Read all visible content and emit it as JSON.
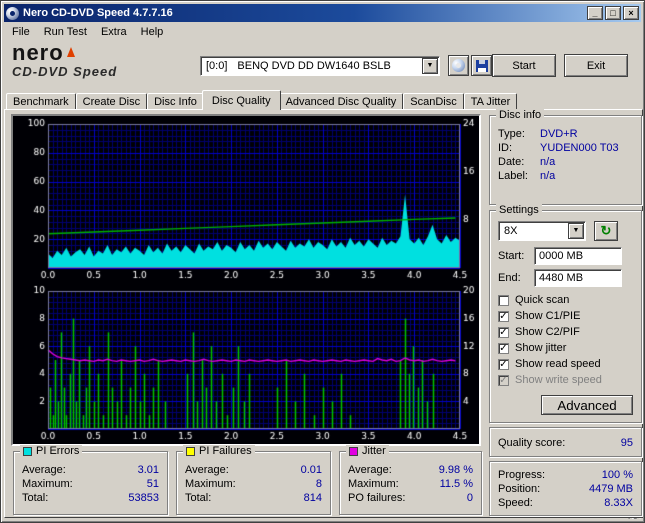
{
  "window": {
    "title": "Nero CD-DVD Speed 4.7.7.16"
  },
  "icons": {
    "minimize": "_",
    "maximize": "□",
    "close": "×",
    "dropdown": "▼",
    "refresh": "↻"
  },
  "menu": {
    "items": [
      "File",
      "Run Test",
      "Extra",
      "Help"
    ]
  },
  "logo": {
    "brand": "nero",
    "product": "CD-DVD Speed"
  },
  "toolbar": {
    "drive_bus": "[0:0]",
    "drive_name": "BENQ DVD DD DW1640 BSLB",
    "start_button": "Start",
    "exit_button": "Exit"
  },
  "tabs": {
    "items": [
      "Benchmark",
      "Create Disc",
      "Disc Info",
      "Disc Quality",
      "Advanced Disc Quality",
      "ScanDisc",
      "TA Jitter"
    ],
    "selected_index": 3
  },
  "disc_info": {
    "title": "Disc info",
    "rows": [
      {
        "label": "Type:",
        "value": "DVD+R"
      },
      {
        "label": "ID:",
        "value": "YUDEN000 T03"
      },
      {
        "label": "Date:",
        "value": "n/a"
      },
      {
        "label": "Label:",
        "value": "n/a"
      }
    ]
  },
  "settings": {
    "title": "Settings",
    "speed_value": "8X",
    "start_label": "Start:",
    "start_value": "0000 MB",
    "end_label": "End:",
    "end_value": "4480 MB",
    "checkboxes": [
      {
        "label": "Quick scan",
        "checked": false,
        "enabled": true
      },
      {
        "label": "Show C1/PIE",
        "checked": true,
        "enabled": true
      },
      {
        "label": "Show C2/PIF",
        "checked": true,
        "enabled": true
      },
      {
        "label": "Show jitter",
        "checked": true,
        "enabled": true
      },
      {
        "label": "Show read speed",
        "checked": true,
        "enabled": true
      },
      {
        "label": "Show write speed",
        "checked": true,
        "enabled": false
      }
    ],
    "advanced_button": "Advanced"
  },
  "quality": {
    "label": "Quality score:",
    "value": "95"
  },
  "progress": {
    "rows": [
      {
        "label": "Progress:",
        "value": "100 %"
      },
      {
        "label": "Position:",
        "value": "4479 MB"
      },
      {
        "label": "Speed:",
        "value": "8.33X"
      }
    ]
  },
  "stat_boxes": [
    {
      "title": "PI Errors",
      "swatch": "#00e0e0",
      "rows": [
        {
          "label": "Average:",
          "value": "3.01"
        },
        {
          "label": "Maximum:",
          "value": "51"
        },
        {
          "label": "Total:",
          "value": "53853"
        }
      ]
    },
    {
      "title": "PI Failures",
      "swatch": "#ffff00",
      "rows": [
        {
          "label": "Average:",
          "value": "0.01"
        },
        {
          "label": "Maximum:",
          "value": "8"
        },
        {
          "label": "Total:",
          "value": "814"
        }
      ]
    },
    {
      "title": "Jitter",
      "swatch": "#e000e0",
      "rows": [
        {
          "label": "Average:",
          "value": "9.98 %"
        },
        {
          "label": "Maximum:",
          "value": "11.5 %"
        },
        {
          "label": "PO failures:",
          "value": "0"
        }
      ]
    }
  ],
  "chart_data": [
    {
      "type": "area",
      "title": "PI Errors and read speed vs disc position (GB)",
      "x_range": [
        0,
        4.5
      ],
      "x_ticks": [
        0.0,
        0.5,
        1.0,
        1.5,
        2.0,
        2.5,
        3.0,
        3.5,
        4.0,
        4.5
      ],
      "left_axis": {
        "range": [
          0,
          100
        ],
        "ticks": [
          20,
          40,
          60,
          80,
          100
        ]
      },
      "right_axis": {
        "range": [
          0,
          24
        ],
        "ticks": [
          8,
          16,
          24
        ]
      },
      "grid": {
        "x_minor": 0.05,
        "x_major": 0.5,
        "y_minor": 4,
        "y_major": 20
      },
      "series": [
        {
          "name": "PI Errors",
          "type": "area",
          "axis": "left",
          "color": "#00e0e0",
          "x_step": 0.05,
          "values": [
            10,
            7,
            12,
            9,
            14,
            8,
            11,
            13,
            9,
            15,
            8,
            12,
            10,
            16,
            9,
            13,
            11,
            15,
            10,
            14,
            12,
            9,
            16,
            11,
            14,
            10,
            17,
            12,
            15,
            11,
            16,
            13,
            10,
            17,
            12,
            15,
            13,
            18,
            12,
            16,
            14,
            11,
            18,
            13,
            16,
            12,
            19,
            14,
            17,
            13,
            18,
            15,
            12,
            19,
            14,
            17,
            15,
            20,
            14,
            18,
            16,
            13,
            20,
            15,
            18,
            14,
            21,
            16,
            19,
            15,
            20,
            17,
            14,
            21,
            16,
            19,
            17,
            22,
            51,
            20,
            17,
            21,
            16,
            22,
            30,
            20,
            17,
            23,
            18,
            21,
            19
          ]
        },
        {
          "name": "Read speed",
          "type": "line",
          "axis": "right",
          "color": "#00b400",
          "x": [
            0,
            0.5,
            1.0,
            1.5,
            2.0,
            2.5,
            3.0,
            3.5,
            4.0,
            4.45
          ],
          "y": [
            5.7,
            6.0,
            6.3,
            6.6,
            6.9,
            7.2,
            7.5,
            7.8,
            8.1,
            8.33
          ]
        }
      ]
    },
    {
      "type": "bar",
      "title": "PI Failures and jitter vs disc position (GB)",
      "x_range": [
        0,
        4.5
      ],
      "x_ticks": [
        0.0,
        0.5,
        1.0,
        1.5,
        2.0,
        2.5,
        3.0,
        3.5,
        4.0,
        4.5
      ],
      "left_axis": {
        "range": [
          0,
          10
        ],
        "ticks": [
          2,
          4,
          6,
          8,
          10
        ]
      },
      "right_axis": {
        "range": [
          0,
          20
        ],
        "ticks": [
          4,
          8,
          12,
          16,
          20
        ]
      },
      "grid": {
        "x_minor": 0.05,
        "x_major": 0.5,
        "y_minor": 0.4,
        "y_major": 2
      },
      "series": [
        {
          "name": "PI Failures",
          "type": "bars",
          "axis": "left",
          "color": "#00c800",
          "points": [
            [
              0.02,
              3
            ],
            [
              0.05,
              1
            ],
            [
              0.08,
              5
            ],
            [
              0.11,
              2
            ],
            [
              0.14,
              7
            ],
            [
              0.17,
              3
            ],
            [
              0.2,
              1
            ],
            [
              0.24,
              4
            ],
            [
              0.27,
              8
            ],
            [
              0.31,
              2
            ],
            [
              0.34,
              5
            ],
            [
              0.38,
              1
            ],
            [
              0.41,
              3
            ],
            [
              0.45,
              6
            ],
            [
              0.5,
              2
            ],
            [
              0.55,
              4
            ],
            [
              0.6,
              1
            ],
            [
              0.65,
              7
            ],
            [
              0.7,
              3
            ],
            [
              0.75,
              2
            ],
            [
              0.8,
              5
            ],
            [
              0.85,
              1
            ],
            [
              0.9,
              3
            ],
            [
              0.95,
              6
            ],
            [
              1.0,
              2
            ],
            [
              1.05,
              4
            ],
            [
              1.1,
              1
            ],
            [
              1.15,
              3
            ],
            [
              1.2,
              5
            ],
            [
              1.28,
              2
            ],
            [
              1.52,
              4
            ],
            [
              1.58,
              7
            ],
            [
              1.63,
              2
            ],
            [
              1.68,
              5
            ],
            [
              1.73,
              3
            ],
            [
              1.78,
              6
            ],
            [
              1.84,
              2
            ],
            [
              1.9,
              4
            ],
            [
              1.96,
              1
            ],
            [
              2.02,
              3
            ],
            [
              2.08,
              6
            ],
            [
              2.14,
              2
            ],
            [
              2.2,
              4
            ],
            [
              2.5,
              3
            ],
            [
              2.6,
              5
            ],
            [
              2.7,
              2
            ],
            [
              2.8,
              4
            ],
            [
              2.9,
              1
            ],
            [
              3.0,
              3
            ],
            [
              3.1,
              2
            ],
            [
              3.2,
              4
            ],
            [
              3.3,
              1
            ],
            [
              3.85,
              5
            ],
            [
              3.9,
              8
            ],
            [
              3.94,
              4
            ],
            [
              3.99,
              6
            ],
            [
              4.04,
              3
            ],
            [
              4.09,
              5
            ],
            [
              4.14,
              2
            ],
            [
              4.2,
              4
            ]
          ]
        },
        {
          "name": "Jitter",
          "type": "line",
          "axis": "right",
          "color": "#e000e0",
          "x_step": 0.05,
          "values": [
            11.5,
            10.9,
            10.5,
            10.3,
            10.2,
            10.1,
            10.0,
            9.9,
            10.0,
            9.9,
            9.8,
            10.0,
            9.9,
            10.1,
            9.9,
            9.8,
            10.0,
            9.9,
            9.8,
            9.9,
            10.0,
            9.8,
            9.9,
            10.1,
            9.9,
            9.8,
            9.9,
            10.0,
            9.9,
            9.8,
            10.0,
            9.9,
            9.8,
            9.9,
            10.1,
            9.9,
            9.8,
            9.9,
            10.0,
            9.9,
            9.8,
            10.0,
            9.9,
            9.8,
            10.0,
            9.9,
            9.8,
            9.9,
            10.0,
            9.9,
            9.8,
            9.9,
            10.0,
            9.8,
            9.9,
            10.0,
            9.9,
            9.8,
            10.0,
            9.9,
            9.8,
            9.9,
            10.0,
            9.9,
            9.8,
            10.0,
            9.9,
            9.8,
            9.9,
            10.0,
            9.9,
            9.8,
            10.2,
            10.0,
            9.9,
            10.1,
            9.8,
            9.9,
            10.3,
            10.0,
            9.9,
            10.0,
            9.8,
            9.9,
            10.1,
            9.9,
            9.8,
            9.9,
            10.0,
            9.9
          ]
        }
      ]
    }
  ]
}
